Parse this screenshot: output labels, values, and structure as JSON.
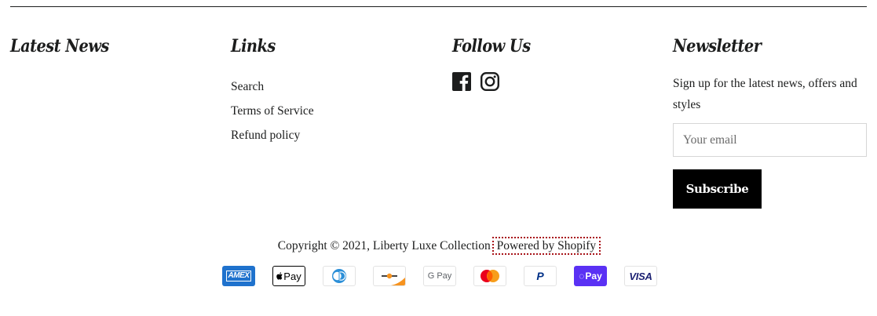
{
  "footer": {
    "columns": {
      "latest_news": {
        "title": "Latest News"
      },
      "links": {
        "title": "Links",
        "items": [
          {
            "label": "Search"
          },
          {
            "label": "Terms of Service"
          },
          {
            "label": "Refund policy"
          }
        ]
      },
      "follow_us": {
        "title": "Follow Us",
        "icons": [
          "facebook-icon",
          "instagram-icon"
        ]
      },
      "newsletter": {
        "title": "Newsletter",
        "text": "Sign up for the latest news, offers and styles",
        "email_placeholder": "Your email",
        "email_value": "",
        "subscribe_label": "Subscribe"
      }
    },
    "copyright": {
      "text": "Copyright © 2021, Liberty Luxe Collection",
      "powered_by": "Powered by Shopify"
    },
    "payment_methods": [
      {
        "name": "American Express",
        "icon": "amex-icon",
        "label": "AMEX"
      },
      {
        "name": "Apple Pay",
        "icon": "apple-pay-icon",
        "label": "Pay"
      },
      {
        "name": "Diners Club",
        "icon": "diners-club-icon"
      },
      {
        "name": "Discover",
        "icon": "discover-icon"
      },
      {
        "name": "Google Pay",
        "icon": "google-pay-icon",
        "label": "G Pay"
      },
      {
        "name": "Mastercard",
        "icon": "mastercard-icon"
      },
      {
        "name": "PayPal",
        "icon": "paypal-icon",
        "label": "P"
      },
      {
        "name": "Shop Pay",
        "icon": "shop-pay-icon",
        "label": "Pay"
      },
      {
        "name": "Visa",
        "icon": "visa-icon",
        "label": "VISA"
      }
    ],
    "colors": {
      "text": "#1c1d1d",
      "button_bg": "#000000",
      "button_text": "#ffffff",
      "amex_blue": "#1f72cd",
      "shop_pay_purple": "#5a31f4",
      "mastercard_red": "#eb001b",
      "mastercard_orange": "#f79e1b",
      "paypal_blue": "#003087",
      "visa_blue": "#1a1f71",
      "focus_outline": "#a8141a"
    }
  }
}
